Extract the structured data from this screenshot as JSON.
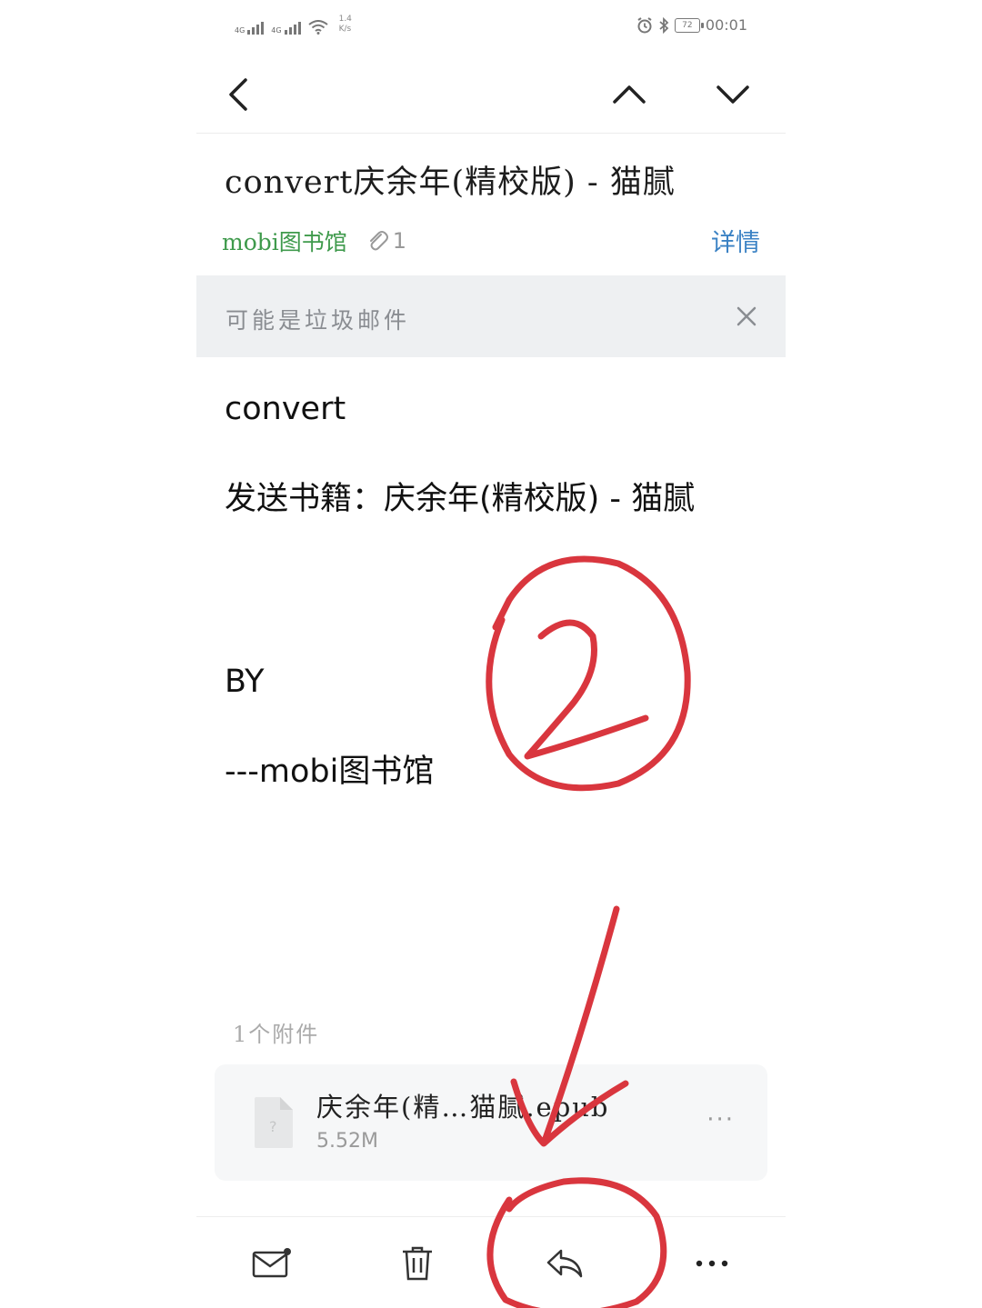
{
  "status_bar": {
    "sim1": "4G",
    "sim2": "4G",
    "speed_value": "1.4",
    "speed_unit": "K/s",
    "battery": "72",
    "time": "00:01"
  },
  "nav": {
    "back_icon": "chevron-left-icon",
    "prev_icon": "chevron-up-icon",
    "next_icon": "chevron-down-icon"
  },
  "email": {
    "subject": "convert庆余年(精校版)  - 猫腻",
    "sender": "mobi图书馆",
    "attachment_count": "1",
    "details_label": "详情"
  },
  "spam_banner": {
    "text": "可能是垃圾邮件"
  },
  "body": {
    "line1": "convert",
    "line2": "发送书籍：庆余年(精校版)   - 猫腻",
    "line3": "BY",
    "line4": "---mobi图书馆"
  },
  "attachments": {
    "count_label": "1个附件",
    "items": [
      {
        "name": "庆余年(精…猫腻.epub",
        "size": "5.52M"
      }
    ],
    "more_label": "···"
  },
  "annotations": {
    "circle_number": "2",
    "color": "#d9363e"
  },
  "colors": {
    "sender_green": "#3f9a4c",
    "link_blue": "#3b82c4",
    "banner_bg": "#eef0f2"
  }
}
